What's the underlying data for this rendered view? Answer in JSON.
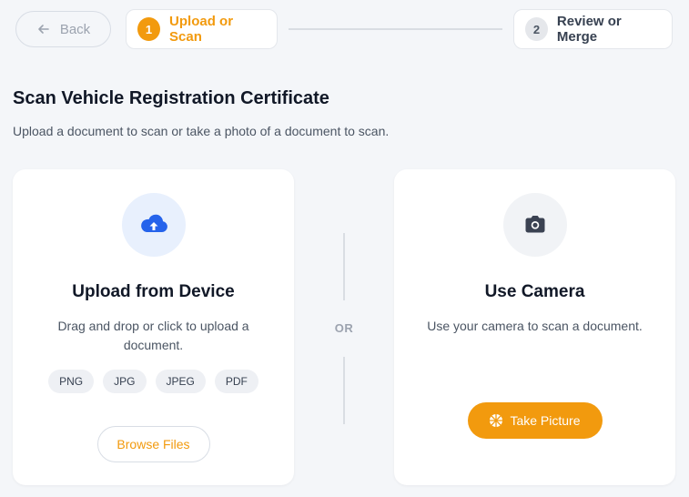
{
  "header": {
    "back_label": "Back",
    "steps": [
      {
        "number": "1",
        "label": "Upload or Scan"
      },
      {
        "number": "2",
        "label": "Review or Merge"
      }
    ]
  },
  "page": {
    "title": "Scan Vehicle Registration Certificate",
    "subtitle": "Upload a document to scan or take a photo of a document to scan."
  },
  "upload_card": {
    "icon": "cloud-upload-icon",
    "title": "Upload from Device",
    "description": "Drag and drop or click to upload a document.",
    "formats": [
      "PNG",
      "JPG",
      "JPEG",
      "PDF"
    ],
    "browse_label": "Browse Files"
  },
  "divider": {
    "label": "OR"
  },
  "camera_card": {
    "icon": "camera-icon",
    "title": "Use Camera",
    "description": "Use your camera to scan a document.",
    "take_label": "Take Picture"
  },
  "colors": {
    "accent": "#f29a0e",
    "upload_icon": "#2563eb",
    "camera_icon": "#3b4252",
    "background": "#f4f6f9"
  }
}
